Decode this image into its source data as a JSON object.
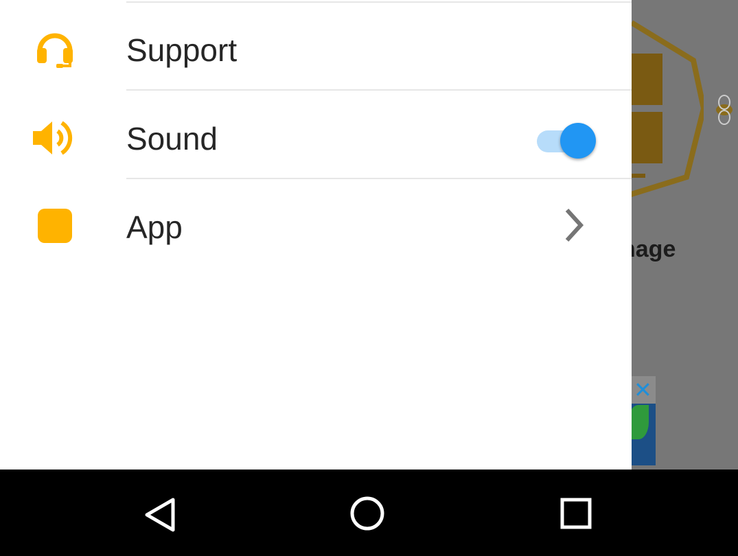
{
  "drawer": {
    "items": [
      {
        "label": "Support",
        "icon": "headset-icon"
      },
      {
        "label": "Sound",
        "icon": "speaker-icon",
        "toggle_on": true
      },
      {
        "label": "App",
        "icon": "app-square-icon",
        "chevron": "chevron-right-icon"
      }
    ]
  },
  "background": {
    "partial_text": "nage"
  },
  "navbar": {
    "back": "back-icon",
    "home": "home-icon",
    "recents": "recents-icon"
  },
  "colors": {
    "accent_icon": "#FFB300",
    "toggle_thumb": "#2196F3",
    "toggle_track": "#B7DCFA",
    "text": "#262626"
  }
}
